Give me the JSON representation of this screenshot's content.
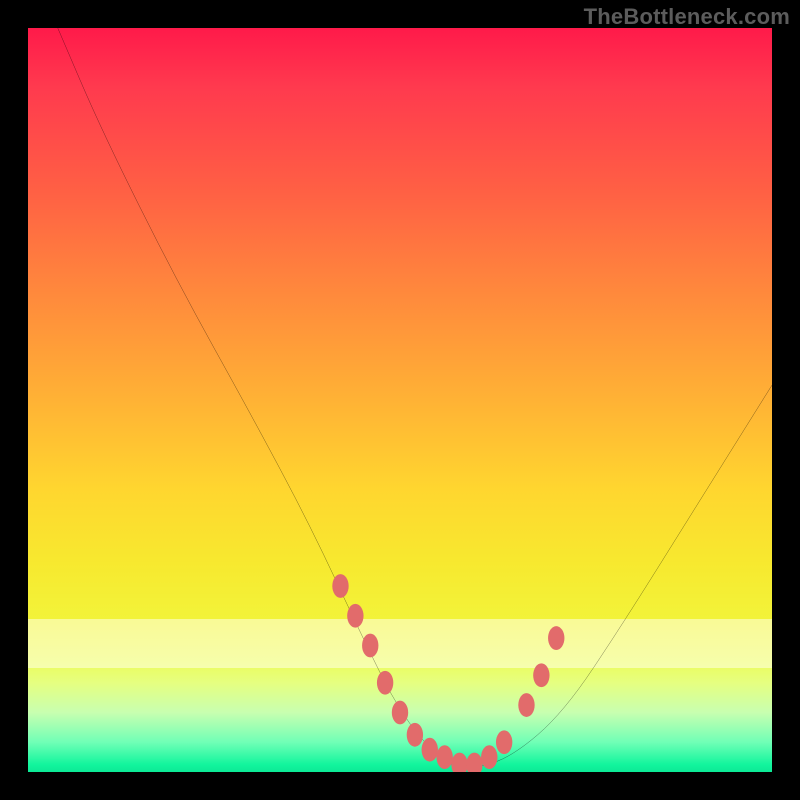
{
  "watermark": "TheBottleneck.com",
  "chart_data": {
    "type": "line",
    "title": "",
    "xlabel": "",
    "ylabel": "",
    "xlim": [
      0,
      100
    ],
    "ylim": [
      0,
      100
    ],
    "grid": false,
    "series": [
      {
        "name": "bottleneck-curve",
        "x": [
          4,
          10,
          20,
          30,
          38,
          45,
          50,
          55,
          58,
          60,
          65,
          72,
          80,
          90,
          100
        ],
        "values": [
          100,
          86,
          66,
          48,
          33,
          18,
          8,
          2,
          0.5,
          0.5,
          2,
          8,
          20,
          36,
          52
        ]
      }
    ],
    "markers": {
      "name": "highlight-dots",
      "color": "#e26b6b",
      "x": [
        42,
        44,
        46,
        48,
        50,
        52,
        54,
        56,
        58,
        60,
        62,
        64,
        67,
        69,
        71
      ],
      "values": [
        25,
        21,
        17,
        12,
        8,
        5,
        3,
        2,
        1,
        1,
        2,
        4,
        9,
        13,
        18
      ]
    },
    "gradient_stops": [
      {
        "pos": 0,
        "color": "#ff1a4a"
      },
      {
        "pos": 50,
        "color": "#ffb235"
      },
      {
        "pos": 85,
        "color": "#ecfc5a"
      },
      {
        "pos": 100,
        "color": "#0ce996"
      }
    ]
  }
}
